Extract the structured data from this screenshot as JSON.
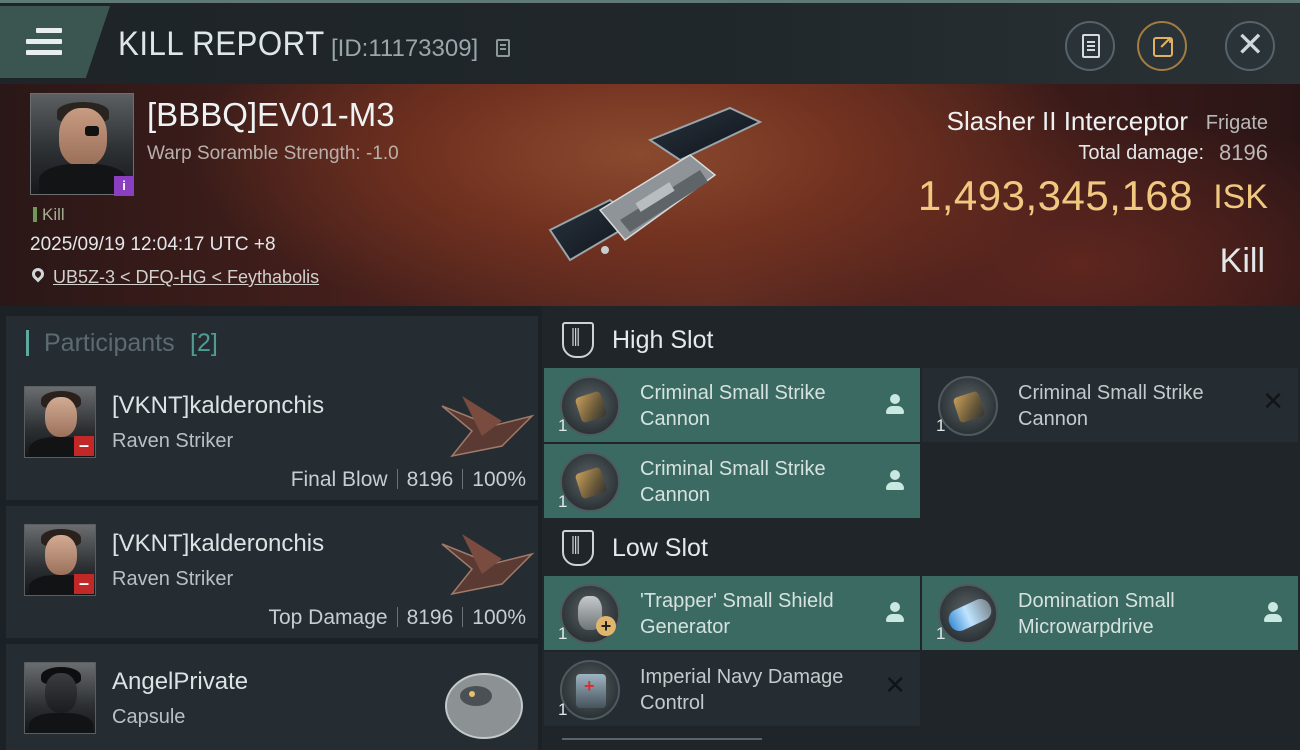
{
  "header": {
    "title": "KILL REPORT",
    "report_id": "[ID:11173309]"
  },
  "victim": {
    "name": "[BBBQ]EV01-M3",
    "scramble": "Warp Soramble Strength: -1.0",
    "tag": "Kill",
    "time": "2025/09/19 12:04:17 UTC +8",
    "location": "UB5Z-3 < DFQ-HG < Feythabolis",
    "ship_name": "Slasher II Interceptor",
    "ship_class": "Frigate",
    "damage_label": "Total damage:",
    "damage_value": "8196",
    "isk_value": "1,493,345,168",
    "isk_unit": "ISK",
    "result": "Kill"
  },
  "participants": {
    "title": "Participants",
    "count": "[2]",
    "list": [
      {
        "name": "[VKNT]kalderonchis",
        "ship": "Raven Striker",
        "role": "Final Blow",
        "damage": "8196",
        "percent": "100%"
      },
      {
        "name": "[VKNT]kalderonchis",
        "ship": "Raven Striker",
        "role": "Top Damage",
        "damage": "8196",
        "percent": "100%"
      },
      {
        "name": "AngelPrivate",
        "ship": "Capsule"
      }
    ]
  },
  "modules": {
    "high_slot_label": "High Slot",
    "low_slot_label": "Low Slot",
    "high": [
      {
        "name": "Criminal Small Strike Cannon",
        "qty": "1",
        "state": "dropped"
      },
      {
        "name": "Criminal Small Strike Cannon",
        "qty": "1",
        "state": "destroyed"
      },
      {
        "name": "Criminal Small Strike Cannon",
        "qty": "1",
        "state": "dropped"
      }
    ],
    "low": [
      {
        "name": "'Trapper' Small Shield Generator",
        "qty": "1",
        "state": "dropped"
      },
      {
        "name": "Domination Small Microwarpdrive",
        "qty": "1",
        "state": "dropped"
      },
      {
        "name": "Imperial Navy Damage Control",
        "qty": "1",
        "state": "destroyed"
      }
    ]
  },
  "colors": {
    "accent_teal": "#3b6a63",
    "isk_gold": "#f0c880",
    "badge_red": "#c22828",
    "badge_purple": "#8a3fc0"
  }
}
